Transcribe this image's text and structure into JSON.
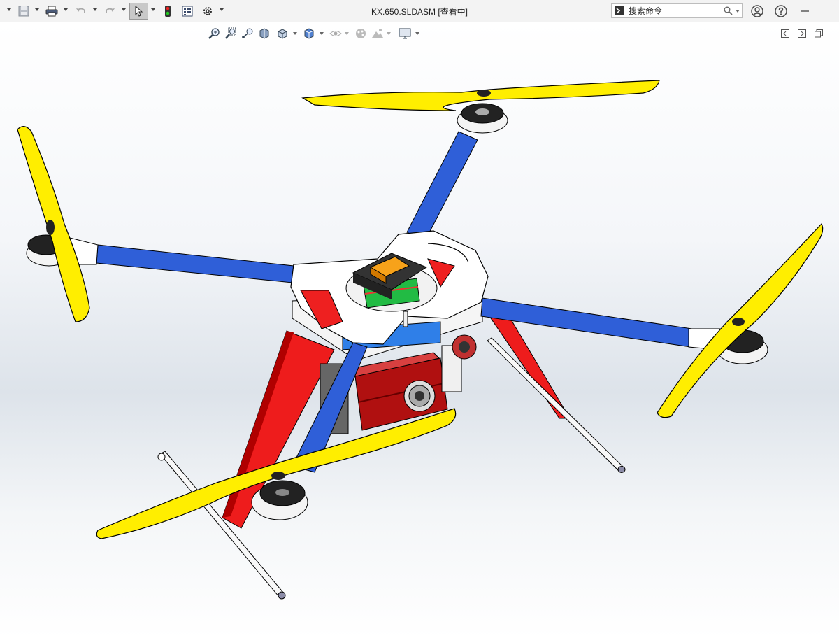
{
  "window": {
    "title": "KX.650.SLDASM [查看中]"
  },
  "search": {
    "placeholder": "搜索命令"
  },
  "toolbar": {
    "icons": [
      "new-icon",
      "save-icon",
      "print-icon",
      "undo-icon",
      "redo-icon",
      "select-icon",
      "rebuild-icon",
      "file-properties-icon",
      "options-icon"
    ]
  },
  "topright": {
    "icons": [
      "account-icon",
      "help-icon",
      "minimize-icon"
    ]
  },
  "heads_up": {
    "icons": [
      "zoom-to-fit-icon",
      "zoom-to-area-icon",
      "previous-view-icon",
      "section-view-icon",
      "view-orientation-icon",
      "display-style-icon",
      "hide-show-items-icon",
      "edit-appearance-icon",
      "apply-scene-icon",
      "view-settings-icon"
    ]
  },
  "colors": {
    "arm": "#2f5fd8",
    "propeller": "#ffee00",
    "leg": "#ee1c1c",
    "camera": "#b01010",
    "plate": "#ffffff",
    "gps": "#f7a21a"
  }
}
